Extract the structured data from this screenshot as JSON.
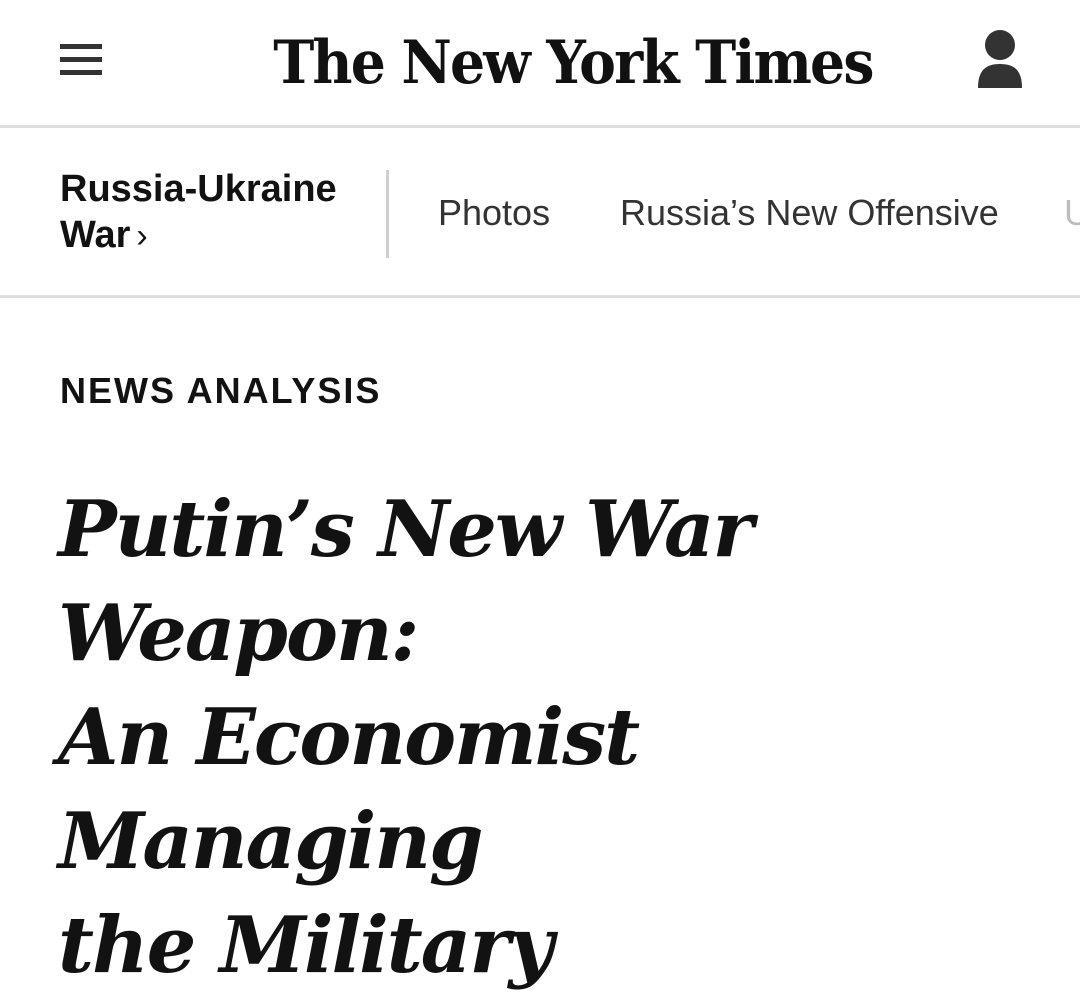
{
  "masthead": {
    "logo_text": "The New York Times",
    "menu_icon": "hamburger-menu-icon",
    "account_icon": "user-account-icon"
  },
  "section_nav": {
    "section_title_line1": "Russia-Ukraine",
    "section_title_line2": "War",
    "chevron": "›",
    "links": [
      {
        "label": "Photos"
      },
      {
        "label": "Russia’s New Offensive"
      },
      {
        "label": "U"
      }
    ]
  },
  "article": {
    "kicker": "NEWS ANALYSIS",
    "headline_lines": [
      "Putin’s New War Weapon:",
      "An Economist Managing",
      "the Military"
    ]
  },
  "colors": {
    "text": "#121212",
    "divider": "#dfdfdf",
    "faded_link": "#bdbdbd"
  }
}
